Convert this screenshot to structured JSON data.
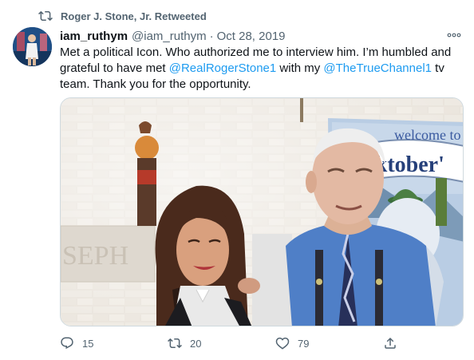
{
  "retweet": {
    "text": "Roger J. Stone, Jr. Retweeted",
    "icon": "retweet-icon"
  },
  "author": {
    "name": "iam_ruthym",
    "handle": "@iam_ruthym",
    "separator": "·",
    "date": "Oct 28, 2019"
  },
  "body": {
    "part1": "Met a political Icon. Who authorized me to interview him. I’m humbled and grateful to have met ",
    "mention1": "@RealRogerStone1",
    "part2": " with my ",
    "mention2": "@TheTrueChannel1",
    "part3": " tv team. Thank you for the opportunity."
  },
  "media": {
    "banner_welcome": "welcome to",
    "banner_oktober": "Oktober'",
    "wall_text": "SEPH"
  },
  "actions": {
    "replies": "15",
    "retweets": "20",
    "likes": "79"
  },
  "colors": {
    "link": "#1d9bf0",
    "muted": "#536471",
    "text": "#0f1419"
  }
}
